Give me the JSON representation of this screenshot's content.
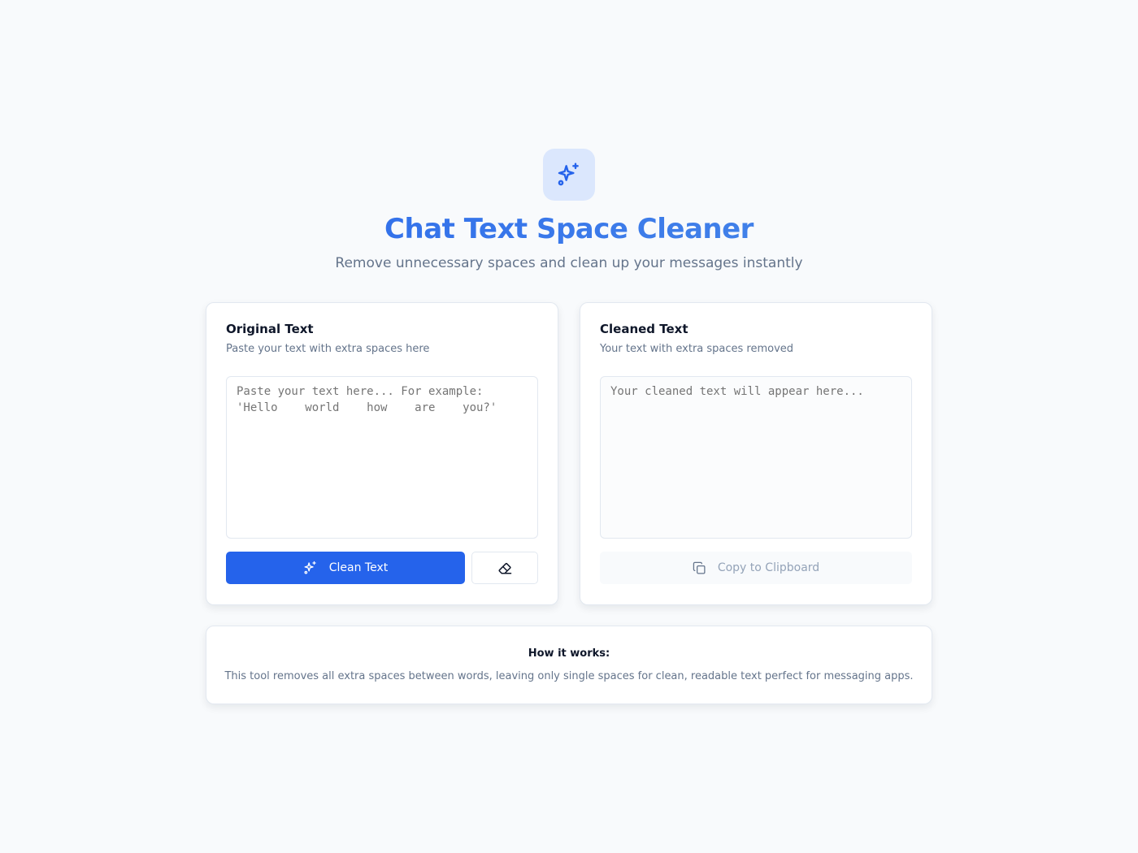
{
  "header": {
    "logo_icon": "sparkles-icon",
    "title": "Chat Text Space Cleaner",
    "subtitle": "Remove unnecessary spaces and clean up your messages instantly"
  },
  "original": {
    "title": "Original Text",
    "description": "Paste your text with extra spaces here",
    "value": "",
    "placeholder": "Paste your text here... For example: 'Hello    world    how    are    you?'",
    "clean_button_label": "Clean Text",
    "clean_button_icon": "sparkles-icon",
    "clear_button_icon": "eraser-icon"
  },
  "cleaned": {
    "title": "Cleaned Text",
    "description": "Your text with extra spaces removed",
    "value": "",
    "placeholder": "Your cleaned text will appear here...",
    "copy_button_label": "Copy to Clipboard",
    "copy_button_icon": "copy-icon"
  },
  "info": {
    "title": "How it works:",
    "text": "This tool removes all extra spaces between words, leaving only single spaces for clean, readable text perfect for messaging apps."
  },
  "colors": {
    "primary": "#2563eb",
    "background": "#f8fafc",
    "muted_text": "#64748b"
  }
}
